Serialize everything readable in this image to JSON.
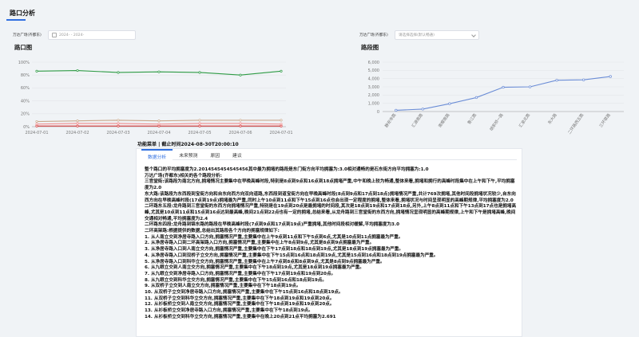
{
  "header": {
    "title": "路口分析"
  },
  "filters": {
    "left_label": "万达广场(齐都东)",
    "date_range": "2024-  - 2024-",
    "right_label": "万达广场(齐都东)",
    "select_placeholder": "请选择选择(默认畅通)"
  },
  "colors": {
    "accent": "#2f6fe0",
    "green": "#2e9b45",
    "tan": "#c9a98c",
    "pink": "#f08b8b",
    "red": "#d83a3a",
    "blue": "#6b8dd6"
  },
  "left_chart": {
    "title": "路口图"
  },
  "right_chart": {
    "title": "路段图"
  },
  "chart_data": [
    {
      "type": "line",
      "title": "路口图",
      "x": [
        "2024-07-01",
        "2024-07-02",
        "2024-07-03",
        "2024-07-04",
        "2024-07-05",
        "2024-07-06",
        "2024-07-01"
      ],
      "y_ticks": [
        "0%",
        "20%",
        "40%",
        "60%",
        "80%",
        "100%"
      ],
      "ylim": [
        0,
        100
      ],
      "series": [
        {
          "color": "#2e9b45",
          "values": [
            86,
            87,
            84,
            85,
            84,
            80,
            86
          ]
        },
        {
          "color": "#c9a98c",
          "values": [
            8,
            9,
            10,
            9,
            10,
            10,
            10
          ]
        },
        {
          "color": "#f08b8b",
          "values": [
            4,
            5,
            5,
            4,
            5,
            5,
            4
          ]
        },
        {
          "color": "#d83a3a",
          "values": [
            1,
            1,
            1,
            1,
            1,
            1,
            1
          ]
        }
      ]
    },
    {
      "type": "line",
      "title": "路段图",
      "categories": [
        "静安寺路",
        "汇源南路",
        "南樱南路",
        "鲁江路",
        "胡家桥一路",
        "汇泉北路",
        "东大路",
        "二环路西五路",
        "三环草路"
      ],
      "values": [
        150,
        300,
        950,
        1700,
        2950,
        3000,
        3800,
        3850,
        4250
      ],
      "y_ticks": [
        "0",
        "1,000",
        "2,000",
        "3,000",
        "4,000",
        "5,000",
        "6,000"
      ],
      "ylim": [
        0,
        6000
      ]
    }
  ],
  "panel": {
    "menu_title": "功能菜单 | 截止时间2024-08-30T20:00:10",
    "tabs": [
      "数据分析",
      "未来预测",
      "原因",
      "建议"
    ],
    "lines": [
      "整个路口的平均拥塞度为2.2014545454545456其中最为拥堵的路段是东门街方向平均拥塞为:3.0相对通畅的是石东街方向平均拥塞为:1.0",
      "万达广场(齐都东)相关的各个路段分析:",
      "三官堂街:该路段为南北方向,拥堵情况主要集中在早晚高峰时段,特别是8点到9点和16点到18点拥堵严重,中午和晚上较为畅通,整体来看,拥堵和拥行的高峰时段集中在上午和下午,平均拥塞度为2.0",
      "东大路:该路段为东西段到宝街方向和自东向西方向双向道路,东西段到道宝街方向在早晚高峰时段(8点到9点和17点到18点)拥堵情况严重,共计769次拥堵,其他时间段拥堵状况较少,自东向西方向在早晚高峰时段(17点到19点)拥堵最为严重,同时上午10点到11点和下午15点到16点也会出现一定程度的拥堵,整体来看,拥堵状况与时间呈现明显的高峰期规律,平均拥塞度为2.0",
      "二环路东五段:龙舟路到三官堂街的东西方向拥堵情况严重,特别是在19点到20点是最拥堵的时间段,其次是18点到19点和17点到18点,另外,上午8点到11点和下午13点到17点也是拥堵高峰,尤其是10点到11点和15点到16点达到最高峰,晚间21点到22点也有一定的拥堵,总结来看,从龙舟路到三官堂街的东西方向,拥堵情况呈现明显的高峰期规律,上午和下午是拥堵高峰,晚间交通相对畅通,平均拥塞度为2.4",
      "二环路东四段:龙舟路到锦东路的路段在早晚高峰时段(7点到9点和17点到19点)严重拥堵,其他时间段相对缓解,平均拥塞度为3.0",
      "二环高架路:根据提供的数据,总结出其路段各个方向的拥塞规律如下:",
      "1. 从人南立交到净居寺路入口方向,拥塞情况严重,主要集中在上午9点到11点和下午5点到6点,尤其是10点到11点拥塞最为严重。",
      "2. 从净居寺路入口到二环高架路入口方向,拥塞情况严重,主要集中在上午8点到9点,尤其是8点到9点拥塞最为严重。",
      "3. 从净居寺路入口到人南立交方向,拥塞情况严重,主要集中在下午17点到18点和18点到19点,尤其是18点到19点拥塞最为严重。",
      "4. 从净居寺路入口到双桥子立交方向,拥塞情况严重,主要集中在下午15点到16点和18点到19点,尤其是15点到16点和18点到19点拥塞最为严重。",
      "5. 从净居寺路入口到科华立交方向,拥塞情况严重,主要集中在上午7点到8点和8点到9点,尤其是8点到9点拥塞最为严重。",
      "6. 从九眼立交到人南立交方向,拥塞情况严重,主要集中在下午18点到19点,尤其是18点到19点拥塞最为严重。",
      "7. 从九眼立交到净居寺路入口方向,拥塞情况严重,主要集中在下午17点到19点和19点到20点。",
      "8. 从九眼立交到科华立交方向,拥塞情况严重,主要集中在下午15点到16点和18点到19点。",
      "9. 从双桥子立交到人南立交方向,拥塞情况严重,主要集中在下午18点到19点。",
      "10. 从双桥子立交到净居寺路入口方向,拥塞情况严重,主要集中在下午15点到16点和18点到19点。",
      "11. 从双桥子立交到科华立交方向,拥塞情况严重,主要集中在下午18点到19点和19点到20点。",
      "12. 从衫板桥立交到人南立交方向,拥塞情况严重,主要集中在下午18点到19点和19点到20点。",
      "13. 从衫板桥立交到净居寺路入口方向,拥塞情况严重,主要集中在下午18点到19点。",
      "14. 从衫板桥立交到科华立交方向,拥塞情况严重,主要集中在晚上20点到21点平均拥塞为2.691"
    ]
  }
}
